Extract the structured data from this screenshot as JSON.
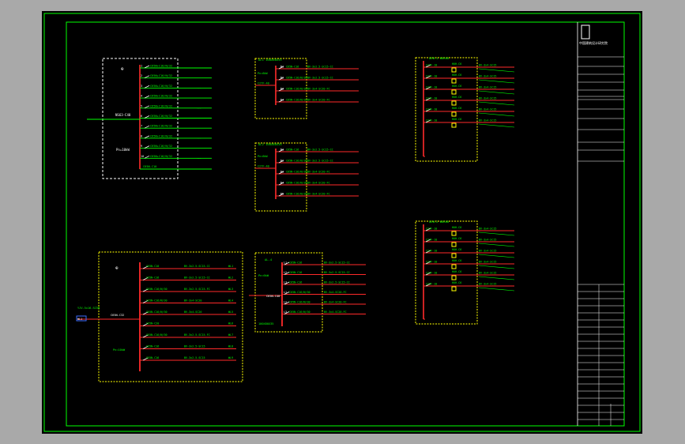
{
  "window": {
    "background": "#a9a9a9",
    "sheet": "#000000"
  },
  "colors": {
    "frame": "#00ff00",
    "bus": "#ff2a2a",
    "wire": "#ffffff",
    "box": "#ffff00",
    "label": "#00ff00"
  },
  "panel_a": {
    "circuits": [
      {
        "no": "1",
        "text": "C65N+C16/N/32"
      },
      {
        "no": "2",
        "text": "C65N+C16/N/32"
      },
      {
        "no": "3",
        "text": "C65N+C16/N/32"
      },
      {
        "no": "4",
        "text": "C65N+C16/N/32"
      },
      {
        "no": "5",
        "text": "C65N+C16/N/32"
      },
      {
        "no": "6",
        "text": "C65N+C16/N/32"
      },
      {
        "no": "7",
        "text": "C65N+C16/N/32"
      },
      {
        "no": "8",
        "text": "C65N+C16/N/32"
      },
      {
        "no": "9",
        "text": "C65N+C16/N/32"
      },
      {
        "no": "10",
        "text": "C65N+C16/N/32"
      }
    ],
    "incoming": "NS63-C40",
    "spare": "C65N-C10",
    "spare_note": "---",
    "info": "Pn=10kW"
  },
  "panel_b": {
    "title": "AL1   100X80X35",
    "info": "Pn=6kW",
    "main": "C27F-40",
    "circuits": [
      {
        "no": "N1",
        "text": "C65N-C16"
      },
      {
        "no": "N2",
        "text": "C65N-C16/N/30"
      },
      {
        "no": "N3",
        "text": "C65N-C16/N/30"
      },
      {
        "no": "N4",
        "text": "C65N-C16/N/30"
      }
    ],
    "cables": [
      "BV-3x2.5-SC15-CC",
      "BV-3x2.5-SC15-CC",
      "BV-3x4-SC20-FC",
      "BV-3x4-SC20-FC"
    ]
  },
  "panel_c": {
    "title": "AL2   100X80X35",
    "info": "Pn=6kW",
    "main": "C27F-40",
    "circuits": [
      {
        "no": "N1",
        "text": "C65N-C16"
      },
      {
        "no": "N2",
        "text": "C65N-C16/N/30"
      },
      {
        "no": "N3",
        "text": "C65N-C16/N/30"
      },
      {
        "no": "N4",
        "text": "C65N-C16/N/30"
      },
      {
        "no": "N5",
        "text": "C65N-C16/N/30"
      }
    ],
    "cables": [
      "BV-3x2.5-SC15-CC",
      "BV-3x2.5-SC15-CC",
      "BV-3x4-SC20-FC",
      "BV-3x4-SC20-FC",
      "BV-3x4-SC20-FC"
    ]
  },
  "panel_d": {
    "title": "AEB-1   80X60",
    "circuits": [
      {
        "sw": "C27F-10",
        "text": "HUH-C6",
        "cable": "BV-3x4-SC15"
      },
      {
        "sw": "C27F-10",
        "text": "HUH-C6",
        "cable": "BV-3x4-SC15"
      },
      {
        "sw": "C27F-10",
        "text": "HUH-C6",
        "cable": "BV-3x4-SC15"
      },
      {
        "sw": "C27F-10",
        "text": "HUH-C6",
        "cable": "BV-3x4-SC15"
      },
      {
        "sw": "C27F-10",
        "text": "HUH-C6",
        "cable": "BV-3x4-SC15"
      },
      {
        "sw": "C27F-10",
        "text": "HUH-C6",
        "cable": "BV-3x4-SC15"
      }
    ]
  },
  "panel_e": {
    "title": "AEB-2   80X60",
    "circuits": [
      {
        "sw": "C27F-10",
        "text": "HUH-C6",
        "cable": "BV-3x4-SC15"
      },
      {
        "sw": "C27F-10",
        "text": "HUH-C6",
        "cable": "BV-3x4-SC15"
      },
      {
        "sw": "C27F-10",
        "text": "HUH-C6",
        "cable": "BV-3x4-SC15"
      },
      {
        "sw": "C27F-10",
        "text": "HUH-C6",
        "cable": "BV-3x4-SC15"
      },
      {
        "sw": "C27F-10",
        "text": "HUH-C6",
        "cable": "BV-3x4-SC15"
      },
      {
        "sw": "C27F-10",
        "text": "HUH-C6",
        "cable": "BV-3x4-SC15"
      }
    ]
  },
  "panel_f": {
    "incoming_cable": "YJV-5x16-SC50",
    "incoming_tag": "WL1",
    "main": "C65N-C32",
    "info": "Pn=10kW",
    "circuits": [
      {
        "sw": "C65N-C10",
        "cable": "BV-3x2.5-SC15-CC",
        "load": "WL1"
      },
      {
        "sw": "C65N-C16",
        "cable": "BV-3x2.5-SC15-CC",
        "load": "WL2"
      },
      {
        "sw": "C65N-C16/N/30",
        "cable": "BV-3x2.5-SC15-FC",
        "load": "WL3"
      },
      {
        "sw": "C65N-C16/N/30",
        "cable": "BV-3x4-SC20",
        "load": "WL4"
      },
      {
        "sw": "C65N-C16/N/30",
        "cable": "BV-3x4-SC20",
        "load": "WL5"
      },
      {
        "sw": "C65N-C20",
        "cable": "",
        "load": "WL6"
      },
      {
        "sw": "C65N-C16/N/30",
        "cable": "BV-3x2.5-SC15-FC",
        "load": "WL7"
      },
      {
        "sw": "C65N-C16",
        "cable": "BV-3x2.5-SC15",
        "load": "WL8"
      },
      {
        "sw": "C65N-C16",
        "cable": "BV-3x2.5-SC15",
        "load": "WL9"
      }
    ]
  },
  "panel_g": {
    "title": "AL-4",
    "info": "Pn=6kW",
    "main": "C65N-C40",
    "note": "100X80X35",
    "circuits": [
      {
        "no": "L1",
        "text": "C65N-C16",
        "cable": "BV-3x2.5-SC15-CC"
      },
      {
        "no": "L2",
        "text": "C65N-C16",
        "cable": "BV-3x2.5-SC15-CC"
      },
      {
        "no": "L3",
        "text": "C65N-C16",
        "cable": "BV-3x2.5-SC15-CC"
      },
      {
        "no": "L1",
        "text": "C65N-C16/N/30",
        "cable": "BV-3x4-SC20-FC"
      },
      {
        "no": "L2",
        "text": "C65N-C16/N/30",
        "cable": "BV-3x4-SC20-FC"
      },
      {
        "no": "L3",
        "text": "C65N-C16/N/30",
        "cable": "BV-3x4-SC20-FC"
      }
    ]
  },
  "title_block": {
    "org": "中国建筑设计研究院",
    "rows": [
      "",
      "",
      "",
      "",
      "",
      "",
      "",
      "",
      "",
      "",
      "",
      "",
      "",
      "",
      ""
    ]
  }
}
